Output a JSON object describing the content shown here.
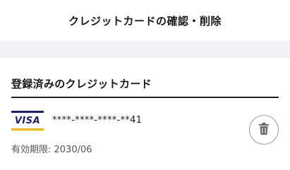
{
  "header": {
    "title": "クレジットカードの確認・削除"
  },
  "section": {
    "title": "登録済みのクレジットカード"
  },
  "card": {
    "brand": "VISA",
    "number": "****-****-****-**41",
    "expiry": "有効期限: 2030/06",
    "brand_colors": {
      "blue": "#1a1f71",
      "gold": "#f7b600"
    }
  },
  "icons": {
    "delete": "trash-icon"
  }
}
